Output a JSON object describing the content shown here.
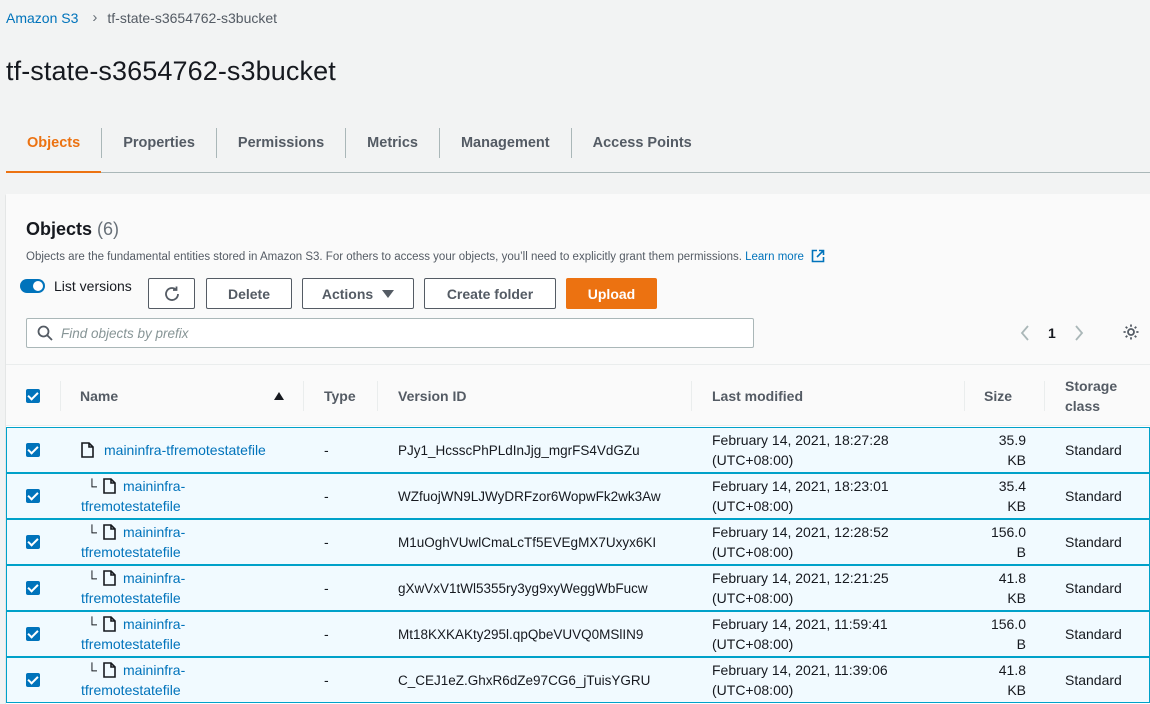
{
  "breadcrumb": {
    "root": "Amazon S3",
    "current": "tf-state-s3654762-s3bucket"
  },
  "page": {
    "title": "tf-state-s3654762-s3bucket"
  },
  "tabs": [
    "Objects",
    "Properties",
    "Permissions",
    "Metrics",
    "Management",
    "Access Points"
  ],
  "objects": {
    "title": "Objects",
    "count": "(6)",
    "description": "Objects are the fundamental entities stored in Amazon S3. For others to access your objects, you’ll need to explicitly grant them permissions.",
    "learn_more": "Learn more",
    "list_versions_label": "List versions",
    "delete_label": "Delete",
    "actions_label": "Actions",
    "create_folder_label": "Create folder",
    "upload_label": "Upload",
    "search_placeholder": "Find objects by prefix",
    "page_number": "1"
  },
  "columns": {
    "name": "Name",
    "type": "Type",
    "version": "Version ID",
    "modified": "Last modified",
    "size": "Size",
    "storage_1": "Storage",
    "storage_2": "class"
  },
  "rows": [
    {
      "name": "maininfra-tfremotestatefile",
      "name_1": "",
      "name_2": "",
      "type": "-",
      "version": "PJy1_HcsscPhPLdInJjg_mgrFS4VdGZu",
      "date": "February 14, 2021, 18:27:28",
      "tz": "(UTC+08:00)",
      "size_1": "35.9",
      "size_2": "KB",
      "storage": "Standard"
    },
    {
      "name": "",
      "name_1": "maininfra-",
      "name_2": "tfremotestatefile",
      "type": "-",
      "version": "WZfuojWN9LJWyDRFzor6WopwFk2wk3Aw",
      "date": "February 14, 2021, 18:23:01",
      "tz": "(UTC+08:00)",
      "size_1": "35.4",
      "size_2": "KB",
      "storage": "Standard"
    },
    {
      "name": "",
      "name_1": "maininfra-",
      "name_2": "tfremotestatefile",
      "type": "-",
      "version": "M1uOghVUwlCmaLcTf5EVEgMX7Uxyx6KI",
      "date": "February 14, 2021, 12:28:52",
      "tz": "(UTC+08:00)",
      "size_1": "156.0",
      "size_2": "B",
      "storage": "Standard"
    },
    {
      "name": "",
      "name_1": "maininfra-",
      "name_2": "tfremotestatefile",
      "type": "-",
      "version": "gXwVxV1tWl5355ry3yg9xyWeggWbFucw",
      "date": "February 14, 2021, 12:21:25",
      "tz": "(UTC+08:00)",
      "size_1": "41.8",
      "size_2": "KB",
      "storage": "Standard"
    },
    {
      "name": "",
      "name_1": "maininfra-",
      "name_2": "tfremotestatefile",
      "type": "-",
      "version": "Mt18KXKAKty295l.qpQbeVUVQ0MSlIN9",
      "date": "February 14, 2021, 11:59:41",
      "tz": "(UTC+08:00)",
      "size_1": "156.0",
      "size_2": "B",
      "storage": "Standard"
    },
    {
      "name": "",
      "name_1": "maininfra-",
      "name_2": "tfremotestatefile",
      "type": "-",
      "version": "C_CEJ1eZ.GhxR6dZe97CG6_jTuisYGRU",
      "date": "February 14, 2021, 11:39:06",
      "tz": "(UTC+08:00)",
      "size_1": "41.8",
      "size_2": "KB",
      "storage": "Standard"
    }
  ],
  "colors": {
    "link": "#0073bb",
    "accent": "#ec7211",
    "selected_row_bg": "#f1faff",
    "selected_row_border": "#00a1c9"
  }
}
